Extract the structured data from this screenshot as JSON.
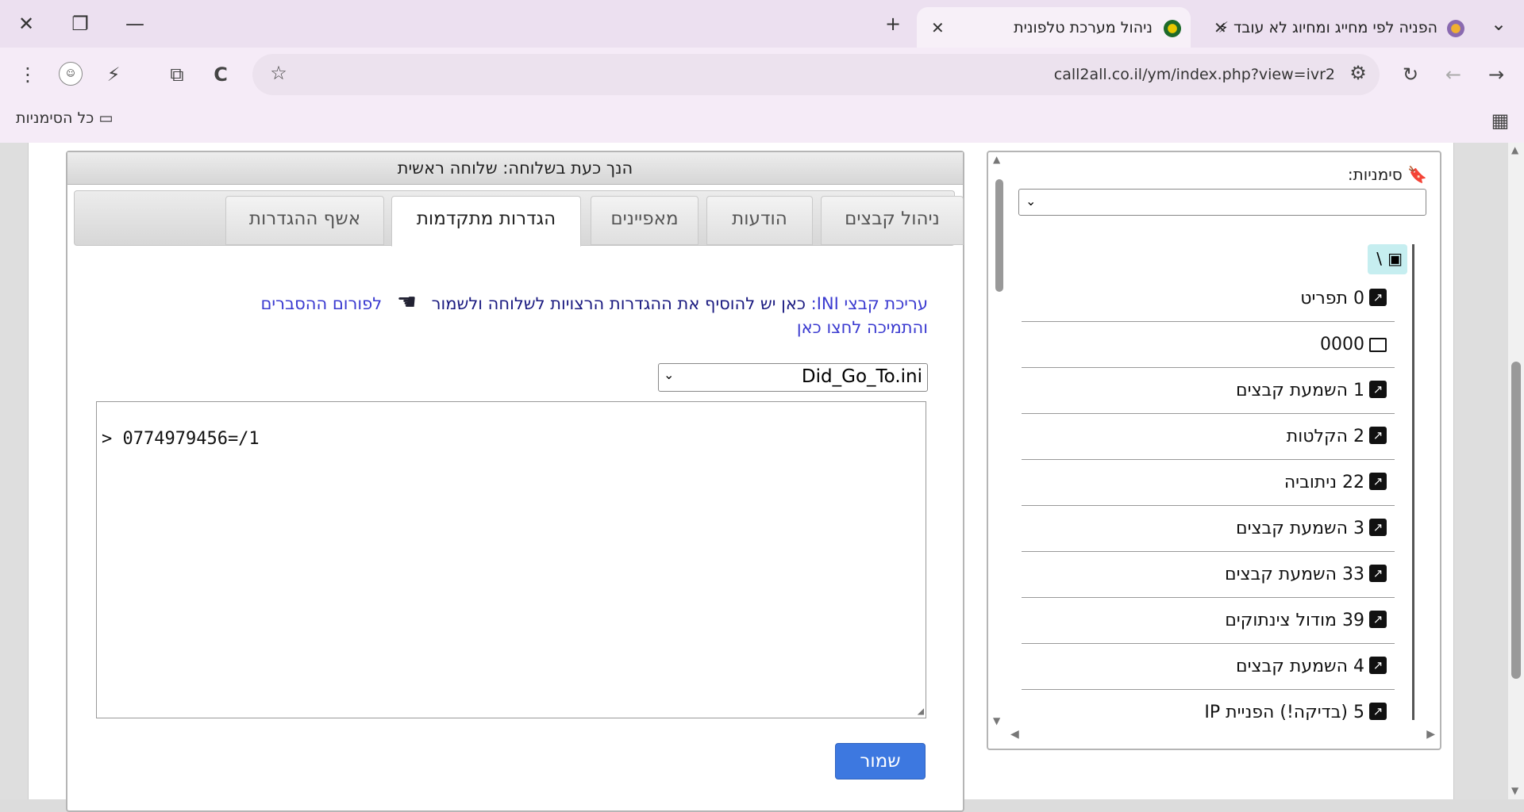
{
  "browser": {
    "tabs": [
      {
        "title": "הפניה לפי מחייג ומחיוג לא עובד ⚡",
        "active": false
      },
      {
        "title": "ניהול מערכת טלפונית",
        "active": true
      }
    ],
    "url": "call2all.co.il/ym/index.php?view=ivr2",
    "bookmarks_label": "כל הסימניות"
  },
  "page": {
    "header": "הנך כעת בשלוחה: שלוחה ראשית",
    "tabs": [
      "ניהול קבצים",
      "הודעות",
      "מאפיינים",
      "הגדרות מתקדמות",
      "אשף ההגדרות"
    ],
    "active_tab": "הגדרות מתקדמות",
    "help": {
      "part1": "עריכת קבצי INI:",
      "part2": "כאן יש להוסיף את ההגדרות הרצויות לשלוחה ולשמור",
      "part3": "לפורום ההסברים",
      "part4": "והתמיכה לחצו כאן"
    },
    "ini_file": "Did_Go_To.ini",
    "editor_content": "> 0774979456=/1",
    "save_label": "שמור"
  },
  "sidebar": {
    "bookmarks_label": "סימניות:",
    "root": "\\",
    "items": [
      {
        "label": "0 תפריט",
        "icon": "shortcut-icon"
      },
      {
        "label": "0000",
        "icon": "folder-icon"
      },
      {
        "label": "1 השמעת קבצים",
        "icon": "shortcut-icon"
      },
      {
        "label": "2 הקלטות",
        "icon": "shortcut-icon"
      },
      {
        "label": "22 ניתוביה",
        "icon": "shortcut-icon"
      },
      {
        "label": "3 השמעת קבצים",
        "icon": "shortcut-icon"
      },
      {
        "label": "33 השמעת קבצים",
        "icon": "shortcut-icon"
      },
      {
        "label": "39 מודול צינתוקים",
        "icon": "shortcut-icon"
      },
      {
        "label": "4 השמעת קבצים",
        "icon": "shortcut-icon"
      },
      {
        "label": "5 (בדיקה!) הפניית IP",
        "icon": "shortcut-icon"
      }
    ]
  }
}
